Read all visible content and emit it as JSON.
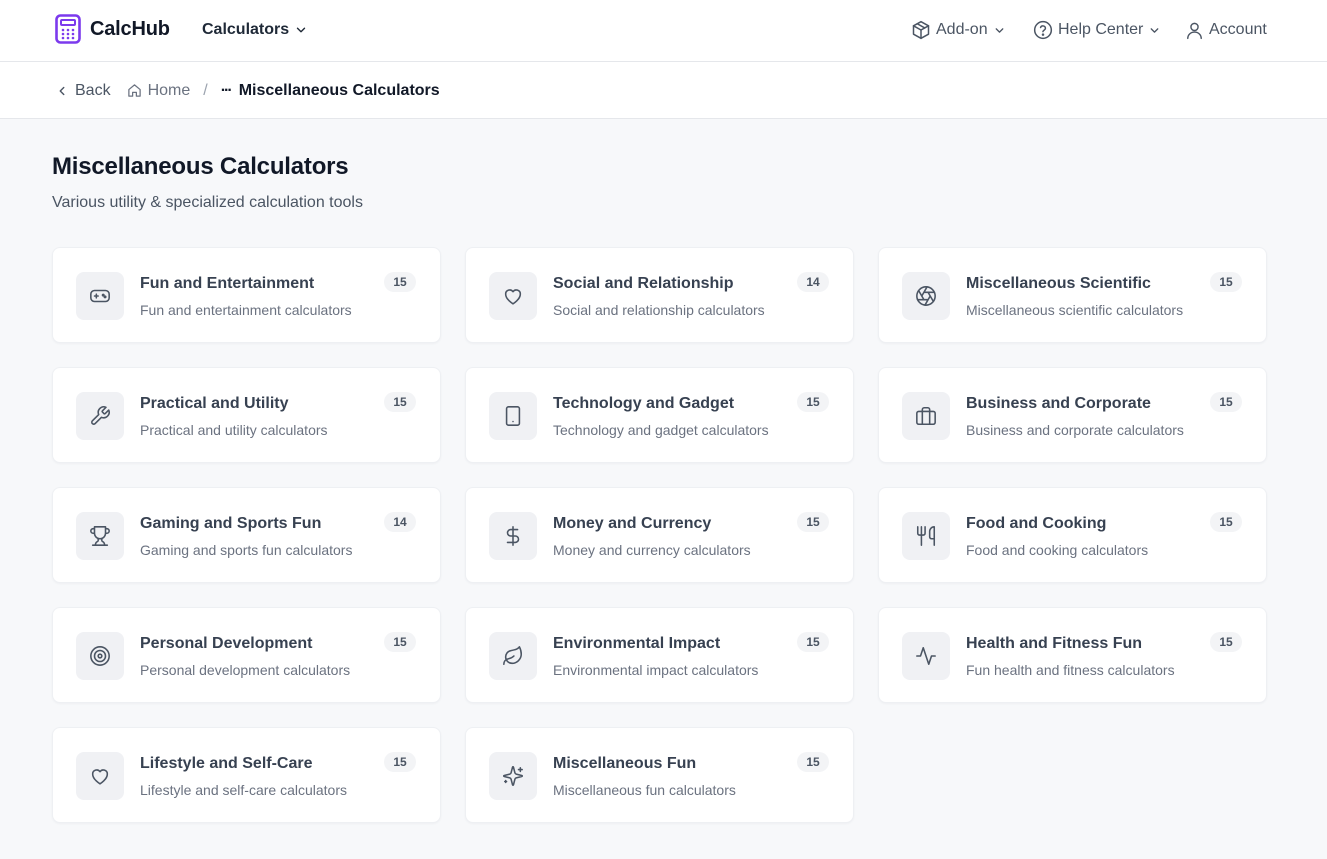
{
  "header": {
    "brand": "CalcHub",
    "brand_color": "#7c3aed",
    "nav_calculators": "Calculators",
    "addon": "Add-on",
    "help_center": "Help Center",
    "account": "Account"
  },
  "breadcrumb": {
    "back": "Back",
    "home": "Home",
    "separator": "/",
    "ellipsis": "···",
    "current": "Miscellaneous Calculators"
  },
  "page": {
    "title": "Miscellaneous Calculators",
    "subtitle": "Various utility & specialized calculation tools"
  },
  "categories": [
    {
      "title": "Fun and Entertainment",
      "desc": "Fun and entertainment calculators",
      "count": "15",
      "icon": "gamepad-icon"
    },
    {
      "title": "Social and Relationship",
      "desc": "Social and relationship calculators",
      "count": "14",
      "icon": "heart-icon"
    },
    {
      "title": "Miscellaneous Scientific",
      "desc": "Miscellaneous scientific calculators",
      "count": "15",
      "icon": "aperture-icon"
    },
    {
      "title": "Practical and Utility",
      "desc": "Practical and utility calculators",
      "count": "15",
      "icon": "wrench-icon"
    },
    {
      "title": "Technology and Gadget",
      "desc": "Technology and gadget calculators",
      "count": "15",
      "icon": "tablet-icon"
    },
    {
      "title": "Business and Corporate",
      "desc": "Business and corporate calculators",
      "count": "15",
      "icon": "briefcase-icon"
    },
    {
      "title": "Gaming and Sports Fun",
      "desc": "Gaming and sports fun calculators",
      "count": "14",
      "icon": "trophy-icon"
    },
    {
      "title": "Money and Currency",
      "desc": "Money and currency calculators",
      "count": "15",
      "icon": "dollar-icon"
    },
    {
      "title": "Food and Cooking",
      "desc": "Food and cooking calculators",
      "count": "15",
      "icon": "utensils-icon"
    },
    {
      "title": "Personal Development",
      "desc": "Personal development calculators",
      "count": "15",
      "icon": "target-icon"
    },
    {
      "title": "Environmental Impact",
      "desc": "Environmental impact calculators",
      "count": "15",
      "icon": "leaf-icon"
    },
    {
      "title": "Health and Fitness Fun",
      "desc": "Fun health and fitness calculators",
      "count": "15",
      "icon": "activity-icon"
    },
    {
      "title": "Lifestyle and Self-Care",
      "desc": "Lifestyle and self-care calculators",
      "count": "15",
      "icon": "heart-icon"
    },
    {
      "title": "Miscellaneous Fun",
      "desc": "Miscellaneous fun calculators",
      "count": "15",
      "icon": "sparkles-icon"
    }
  ]
}
